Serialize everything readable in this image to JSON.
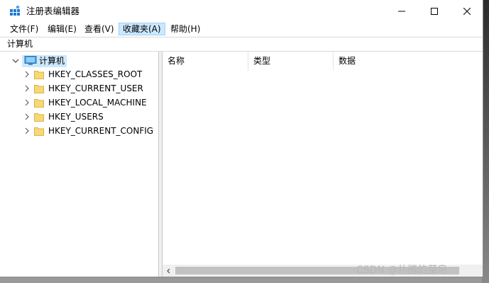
{
  "window": {
    "title": "注册表编辑器",
    "icon": "regedit-icon",
    "controls": [
      "minimize",
      "maximize",
      "close"
    ]
  },
  "menu": [
    {
      "label": "文件(F)"
    },
    {
      "label": "编辑(E)"
    },
    {
      "label": "查看(V)"
    },
    {
      "label": "收藏夹(A)"
    },
    {
      "label": "帮助(H)"
    }
  ],
  "address": {
    "value": "计算机"
  },
  "tree": {
    "root": {
      "label": "计算机",
      "icon": "computer-icon",
      "expanded": true
    },
    "keys": [
      {
        "label": "HKEY_CLASSES_ROOT"
      },
      {
        "label": "HKEY_CURRENT_USER"
      },
      {
        "label": "HKEY_LOCAL_MACHINE"
      },
      {
        "label": "HKEY_USERS"
      },
      {
        "label": "HKEY_CURRENT_CONFIG"
      }
    ]
  },
  "list": {
    "columns": [
      {
        "label": "名称"
      },
      {
        "label": "类型"
      },
      {
        "label": "数据"
      }
    ]
  },
  "watermark": "CSDN @扑腾的菜鸟",
  "colors": {
    "selection": "#cce8ff",
    "folder": "#f8d775",
    "icon_blue": "#1e7bd0"
  }
}
